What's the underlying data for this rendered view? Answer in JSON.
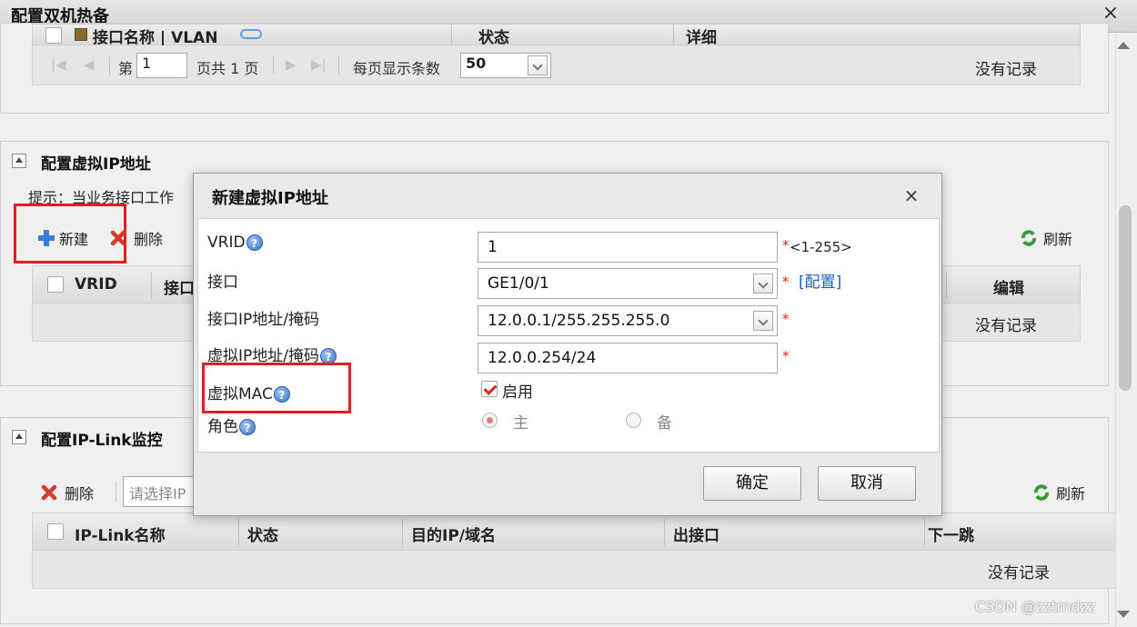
{
  "window": {
    "title": "配置双机热备",
    "close_glyph": "×"
  },
  "interface_panel": {
    "columns": [
      "接口名称 | VLAN",
      "状态",
      "详细"
    ],
    "pager": {
      "first": "|◀",
      "prev": "◀",
      "page_prefix": "第",
      "page_value": "1",
      "page_suffix": "页共 1 页",
      "next": "▶",
      "last": "▶|",
      "per_page_label": "每页显示条数",
      "per_page_value": "50"
    },
    "no_records": "没有记录"
  },
  "vip_panel": {
    "title": "配置虚拟IP地址",
    "hint": "提示：当业务接口工作",
    "toolbar": {
      "new_label": "新建",
      "delete_label": "删除",
      "refresh_label": "刷新"
    },
    "columns": [
      "VRID",
      "接口",
      "编辑"
    ],
    "no_records": "没有记录"
  },
  "iplink_panel": {
    "title": "配置IP-Link监控",
    "toolbar": {
      "delete_label": "删除",
      "select_placeholder": "请选择IP",
      "refresh_label": "刷新"
    },
    "columns": [
      "IP-Link名称",
      "状态",
      "目的IP/域名",
      "出接口",
      "下一跳"
    ],
    "no_records": "没有记录"
  },
  "dialog": {
    "title": "新建虚拟IP地址",
    "close_glyph": "×",
    "fields": {
      "vrid": {
        "label": "VRID",
        "value": "1",
        "required": "*",
        "range": "<1-255>"
      },
      "interface": {
        "label": "接口",
        "value": "GE1/0/1",
        "required": "*",
        "config_link": "[配置]"
      },
      "interface_ip": {
        "label": "接口IP地址/掩码",
        "value": "12.0.0.1/255.255.255.0",
        "required": "*"
      },
      "virtual_ip": {
        "label": "虚拟IP地址/掩码",
        "value": "12.0.0.254/24",
        "required": "*"
      },
      "virtual_mac": {
        "label": "虚拟MAC",
        "option": "启用",
        "checked": true
      },
      "role": {
        "label": "角色",
        "options": [
          "主",
          "备"
        ],
        "selected": "主"
      }
    },
    "buttons": {
      "ok": "确定",
      "cancel": "取消"
    },
    "help_glyph": "?"
  },
  "watermark": "CSDN @zztmdzz",
  "colors": {
    "highlight": "#e02020",
    "link": "#1a5fd0",
    "delete": "#d63a2e",
    "add": "#3a7fd0",
    "refresh": "#3a9a3a"
  }
}
